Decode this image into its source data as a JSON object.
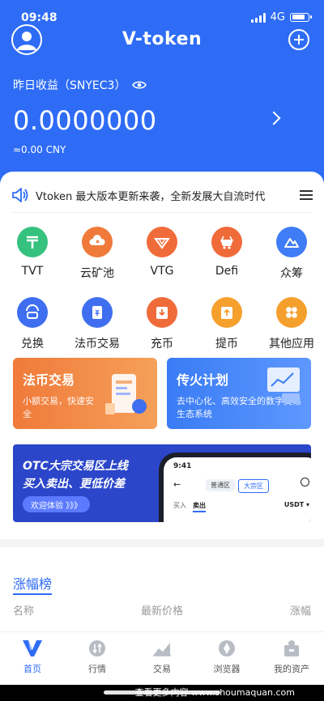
{
  "status": {
    "time": "09:48",
    "network": "4G"
  },
  "header": {
    "title": "V-token",
    "earnings_label": "昨日收益（SNYEC3）",
    "balance": "0.0000000",
    "cny": "≈0.00 CNY",
    "bg_color": "#2e6cf6"
  },
  "notice": {
    "text": "Vtoken 最大版本更新来袭，全新发展大自流时代"
  },
  "grid": {
    "items": [
      {
        "label": "TVT",
        "icon": "tvt-icon",
        "color": "#35c27f"
      },
      {
        "label": "云矿池",
        "icon": "cloud-pool-icon",
        "color": "#f07a3a"
      },
      {
        "label": "VTG",
        "icon": "vtg-icon",
        "color": "#f06b3a"
      },
      {
        "label": "Defi",
        "icon": "defi-icon",
        "color": "#f06b3a"
      },
      {
        "label": "众筹",
        "icon": "crowdfund-icon",
        "color": "#3f7cf5"
      },
      {
        "label": "兑换",
        "icon": "exchange-icon",
        "color": "#3f6ff0"
      },
      {
        "label": "法币交易",
        "icon": "fiat-trade-icon",
        "color": "#3f6ff0"
      },
      {
        "label": "充币",
        "icon": "deposit-icon",
        "color": "#f06b3a"
      },
      {
        "label": "提币",
        "icon": "withdraw-icon",
        "color": "#f5a02d"
      },
      {
        "label": "其他应用",
        "icon": "more-apps-icon",
        "color": "#f5a02d"
      }
    ]
  },
  "promos": [
    {
      "title": "法币交易",
      "sub": "小额交易，快速安全",
      "color": "#f07a3a"
    },
    {
      "title": "传火计划",
      "sub": "去中心化、高效安全的数字交易生态系统",
      "color": "#3a7cf5"
    }
  ],
  "otc": {
    "line1": "OTC大宗交易区上线",
    "line2": "买入卖出、更低价差",
    "button": "欢迎体验 》》》",
    "phone": {
      "time": "9:41",
      "tab1": "普通区",
      "tab2": "大宗区",
      "buy": "买入",
      "sell": "卖出",
      "coin": "USDT ▾"
    }
  },
  "rank": {
    "title": "涨幅榜",
    "col_name": "名称",
    "col_price": "最新价格",
    "col_change": "涨幅"
  },
  "nav": [
    {
      "label": "首页",
      "icon": "home-v-icon",
      "active": true
    },
    {
      "label": "行情",
      "icon": "market-icon",
      "active": false
    },
    {
      "label": "交易",
      "icon": "trade-icon",
      "active": false
    },
    {
      "label": "浏览器",
      "icon": "browser-icon",
      "active": false
    },
    {
      "label": "我的资产",
      "icon": "assets-icon",
      "active": false
    }
  ],
  "watermark": "查看更多内容 www.shoumaquan.com"
}
